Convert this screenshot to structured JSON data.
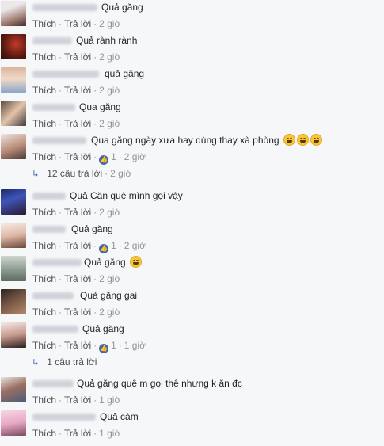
{
  "ui": {
    "like_label": "Thích",
    "reply_label": "Trả lời",
    "separator": "·",
    "like_icon": "thumbs-up-icon",
    "reply_icon": "reply-arrow-icon",
    "colors": {
      "link": "#4b4f56",
      "meta": "#90949c",
      "like_badge": "#4267b2",
      "background": "#f6f7f9"
    }
  },
  "comments": [
    {
      "text": "Quả găng",
      "likes": "",
      "time": "2 giờ",
      "emojis": 0
    },
    {
      "text": "Quả rành rành",
      "likes": "",
      "time": "2 giờ",
      "emojis": 0
    },
    {
      "text": "quả găng",
      "likes": "",
      "time": "2 giờ",
      "emojis": 0
    },
    {
      "text": "Qua găng",
      "likes": "",
      "time": "2 giờ",
      "emojis": 0
    },
    {
      "text": "Qua găng ngày xưa hay dùng thay xà phòng",
      "likes": "1",
      "time": "2 giờ",
      "emojis": 3
    },
    {
      "text": "Quả Căn quê mình gọi vậy",
      "likes": "",
      "time": "2 giờ",
      "emojis": 0
    },
    {
      "text": "Quả găng",
      "likes": "1",
      "time": "2 giờ",
      "emojis": 0
    },
    {
      "text": "Quả găng",
      "likes": "",
      "time": "2 giờ",
      "emojis": 1
    },
    {
      "text": "Quả găng gai",
      "likes": "",
      "time": "2 giờ",
      "emojis": 0
    },
    {
      "text": "Quả găng",
      "likes": "1",
      "time": "1 giờ",
      "emojis": 0
    },
    {
      "text": "Quả găng quê m gọi thê nhưng k ăn đc",
      "likes": "",
      "time": "1 giờ",
      "emojis": 0
    },
    {
      "text": "Quả câm",
      "likes": "",
      "time": "1 giờ",
      "emojis": 0
    }
  ],
  "reply_threads": [
    {
      "label": "12 câu trả lời",
      "time": "2 giờ"
    },
    {
      "label": "1 câu trả lời",
      "time": ""
    }
  ]
}
